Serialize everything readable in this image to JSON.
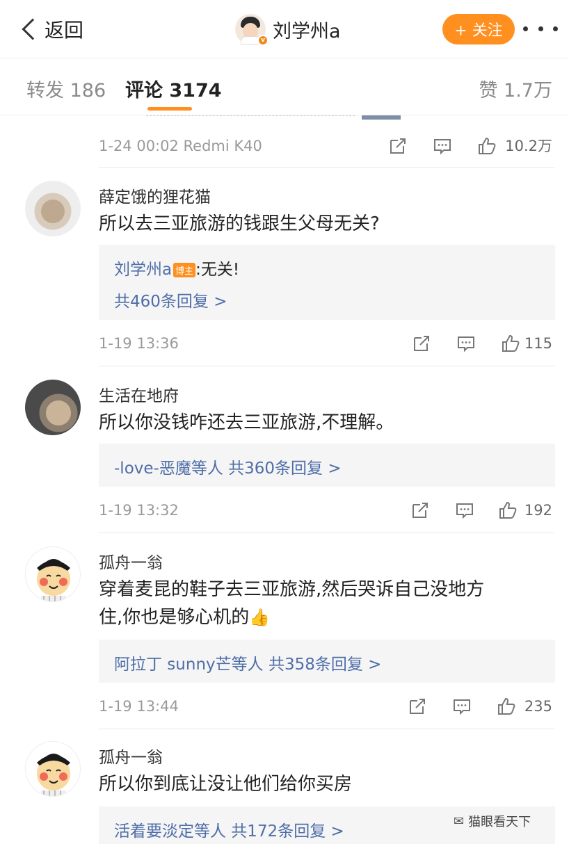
{
  "header": {
    "back_label": "返回",
    "profile_name": "刘学州a",
    "follow_label": "+ 关注"
  },
  "tabs": {
    "repost": "转发 186",
    "comments": "评论 3174",
    "likes": "赞 1.7万"
  },
  "post_meta": {
    "time": "1-24 00:02  Redmi K40",
    "likes": "10.2万"
  },
  "comments": [
    {
      "user": "薛定饿的狸花猫",
      "text": "所以去三亚旅游的钱跟生父母无关?",
      "reply_author": "刘学州a",
      "reply_tag": "博主",
      "reply_text": ":无关!",
      "reply_count": "共460条回复 >",
      "time": "1-19 13:36",
      "likes": "115"
    },
    {
      "user": "生活在地府",
      "text": "所以你没钱咋还去三亚旅游,不理解。",
      "reply_summary": "-love-恶魔等人  共360条回复 >",
      "time": "1-19 13:32",
      "likes": "192"
    },
    {
      "user": "孤舟一翁",
      "text_line1": "穿着麦昆的鞋子去三亚旅游,然后哭诉自己没地方",
      "text_line2": "住,你也是够心机的",
      "reply_summary": "阿拉丁 sunny芒等人  共358条回复 >",
      "time": "1-19 13:44",
      "likes": "235"
    },
    {
      "user": "孤舟一翁",
      "text": "所以你到底让没让他们给你买房",
      "reply_summary": "活着要淡定等人  共172条回复 >"
    }
  ],
  "watermark": "猫眼看天下",
  "colors": {
    "accent": "#ff8f1f",
    "link": "#4f6ea8",
    "muted": "#999999"
  }
}
